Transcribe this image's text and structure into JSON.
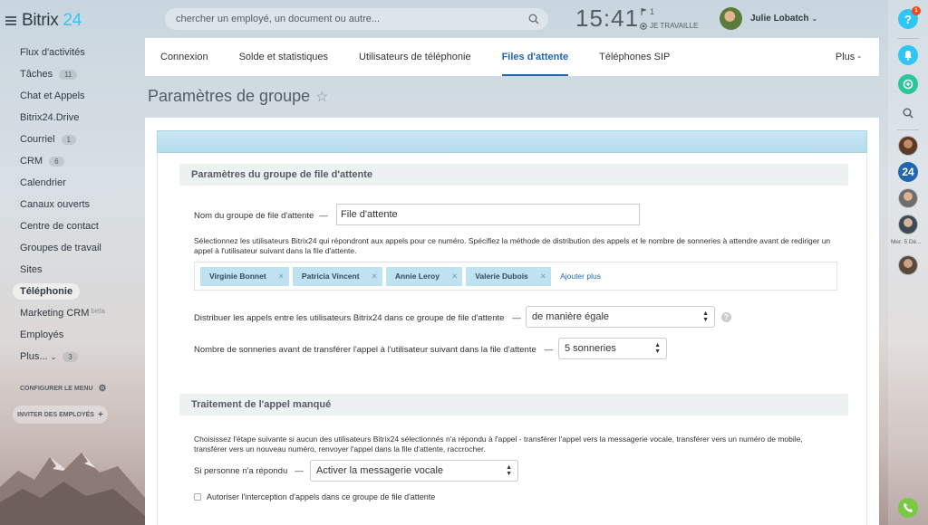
{
  "header": {
    "logo_brand": "Bitrix",
    "logo_num": "24",
    "search_placeholder": "chercher un employé, un document ou autre...",
    "clock": "15:41",
    "flag_count": "1",
    "work_status": "JE TRAVAILLE",
    "user_name": "Julie Lobatch"
  },
  "sidebar": {
    "items": [
      {
        "label": "Flux d'activités"
      },
      {
        "label": "Tâches",
        "count": "11"
      },
      {
        "label": "Chat et Appels"
      },
      {
        "label": "Bitrix24.Drive"
      },
      {
        "label": "Courriel",
        "count": "1"
      },
      {
        "label": "CRM",
        "count": "6"
      },
      {
        "label": "Calendrier"
      },
      {
        "label": "Canaux ouverts"
      },
      {
        "label": "Centre de contact"
      },
      {
        "label": "Groupes de travail"
      },
      {
        "label": "Sites"
      },
      {
        "label": "Téléphonie"
      },
      {
        "label": "Marketing CRM",
        "beta": "beta"
      },
      {
        "label": "Employés"
      },
      {
        "label": "Plus...",
        "count": "3"
      }
    ],
    "configure_label": "CONFIGURER LE MENU",
    "invite_label": "INVITER DES EMPLOYÉS"
  },
  "tabs": [
    {
      "label": "Connexion"
    },
    {
      "label": "Solde et statistiques"
    },
    {
      "label": "Utilisateurs de téléphonie"
    },
    {
      "label": "Files d'attente"
    },
    {
      "label": "Téléphones SIP"
    },
    {
      "label": "Plus -"
    }
  ],
  "page_title": "Paramètres de groupe",
  "queue_section": {
    "title": "Paramètres du groupe de file d'attente",
    "name_label": "Nom du groupe de file d'attente",
    "name_value": "File d'attente",
    "description": "Sélectionnez les utilisateurs Bitrix24 qui répondront aux appels pour ce numéro. Spécifiez la méthode de distribution des appels et le nombre de sonneries à attendre avant de rediriger un appel à l'utilisateur suivant dans la file d'attente.",
    "users": [
      "Virginie Bonnet",
      "Patricia Vincent",
      "Annie Leroy",
      "Valerie Dubois"
    ],
    "add_more": "Ajouter plus",
    "distribute_label": "Distribuer les appels entre les utilisateurs Bitrix24 dans ce groupe de file d'attente",
    "distribute_value": "de manière égale",
    "rings_label": "Nombre de sonneries avant de transférer l'appel à l'utilisateur suivant dans la file d'attente",
    "rings_value": "5 sonneries"
  },
  "missed_section": {
    "title": "Traitement de l'appel manqué",
    "description": "Choisissez l'étape suivante si aucun des utilisateurs Bitrix24 sélectionnés n'a répondu à l'appel - transférer l'appel vers la messagerie vocale, transférer vers un numéro de mobile, transférer vers un nouveau numéro, renvoyer l'appel dans la file d'attente, raccrocher.",
    "no_answer_label": "Si personne n'a répondu",
    "no_answer_value": "Activer la messagerie vocale",
    "intercept_label": "Autoriser l'interception d'appels dans ce groupe de file d'attente"
  },
  "rightbar": {
    "help_badge": "1",
    "b24_label": "24",
    "date_label": "Mer. 5 Dé..."
  }
}
